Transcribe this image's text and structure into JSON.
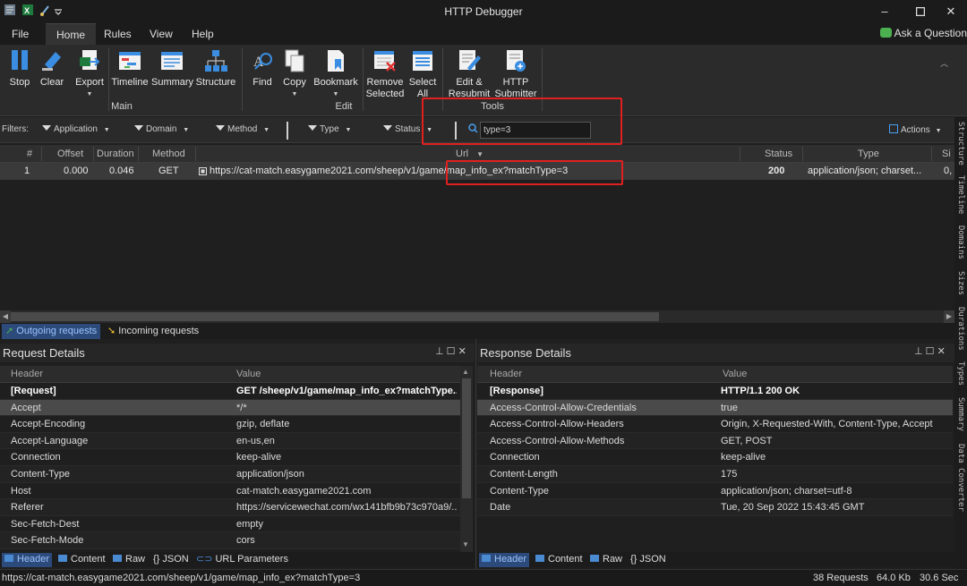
{
  "window": {
    "title": "HTTP Debugger"
  },
  "menu": {
    "items": [
      "File",
      "Home",
      "Rules",
      "View",
      "Help"
    ],
    "ask": "Ask a Question"
  },
  "ribbon": {
    "stop": "Stop",
    "clear": "Clear",
    "export": "Export",
    "timeline": "Timeline",
    "summary": "Summary",
    "structure": "Structure",
    "find": "Find",
    "copy": "Copy",
    "bookmark": "Bookmark",
    "remove_line1": "Remove",
    "remove_line2": "Selected",
    "select_line1": "Select",
    "select_line2": "All",
    "edit_line1": "Edit &",
    "edit_line2": "Resubmit",
    "http_line1": "HTTP",
    "http_line2": "Submitter",
    "group_main": "Main",
    "group_edit": "Edit",
    "group_tools": "Tools"
  },
  "filters": {
    "label": "Filters:",
    "application": "Application",
    "domain": "Domain",
    "method": "Method",
    "type": "Type",
    "status": "Status",
    "input_value": "type=3",
    "actions": "Actions"
  },
  "grid": {
    "headers": [
      "#",
      "Offset",
      "Duration",
      "Method",
      "Url",
      "Status",
      "Type",
      "Si"
    ],
    "rows": [
      {
        "num": "1",
        "offset": "0.000",
        "duration": "0.046",
        "method": "GET",
        "url": "https://cat-match.easygame2021.com/sheep/v1/game/map_info_ex?matchType=3",
        "status": "200",
        "type": "application/json; charset...",
        "size": "0,"
      }
    ]
  },
  "tabs": {
    "outgoing": "Outgoing requests",
    "incoming": "Incoming requests"
  },
  "request": {
    "title": "Request Details",
    "col_header": "Header",
    "col_value": "Value",
    "rows": [
      {
        "h": "[Request]",
        "v": "GET /sheep/v1/game/map_info_ex?matchType..."
      },
      {
        "h": "Accept",
        "v": "*/*"
      },
      {
        "h": "Accept-Encoding",
        "v": "gzip, deflate"
      },
      {
        "h": "Accept-Language",
        "v": "en-us,en"
      },
      {
        "h": "Connection",
        "v": "keep-alive"
      },
      {
        "h": "Content-Type",
        "v": "application/json"
      },
      {
        "h": "Host",
        "v": "cat-match.easygame2021.com"
      },
      {
        "h": "Referer",
        "v": "https://servicewechat.com/wx141bfb9b73c970a9/..."
      },
      {
        "h": "Sec-Fetch-Dest",
        "v": "empty"
      },
      {
        "h": "Sec-Fetch-Mode",
        "v": "cors"
      }
    ],
    "tabs": [
      "Header",
      "Content",
      "Raw",
      "JSON",
      "URL Parameters"
    ]
  },
  "response": {
    "title": "Response Details",
    "col_header": "Header",
    "col_value": "Value",
    "rows": [
      {
        "h": "[Response]",
        "v": "HTTP/1.1 200 OK"
      },
      {
        "h": "Access-Control-Allow-Credentials",
        "v": "true"
      },
      {
        "h": "Access-Control-Allow-Headers",
        "v": "Origin, X-Requested-With, Content-Type, Accept"
      },
      {
        "h": "Access-Control-Allow-Methods",
        "v": "GET, POST"
      },
      {
        "h": "Connection",
        "v": "keep-alive"
      },
      {
        "h": "Content-Length",
        "v": "175"
      },
      {
        "h": "Content-Type",
        "v": "application/json; charset=utf-8"
      },
      {
        "h": "Date",
        "v": "Tue, 20 Sep 2022 15:43:45 GMT"
      }
    ],
    "tabs": [
      "Header",
      "Content",
      "Raw",
      "JSON"
    ]
  },
  "status": {
    "url": "https://cat-match.easygame2021.com/sheep/v1/game/map_info_ex?matchType=3",
    "requests": "38 Requests",
    "size": "64.0 Kb",
    "time": "30.6 Sec"
  },
  "side_tabs": [
    "Structure",
    "Timeline",
    "Domains",
    "Sizes",
    "Durations",
    "Types",
    "Summary",
    "Data Converter"
  ],
  "colors": {
    "highlight_box": "#e02020",
    "active_tab": "#2c4a7a",
    "selected_row": "#3a3a3a"
  }
}
